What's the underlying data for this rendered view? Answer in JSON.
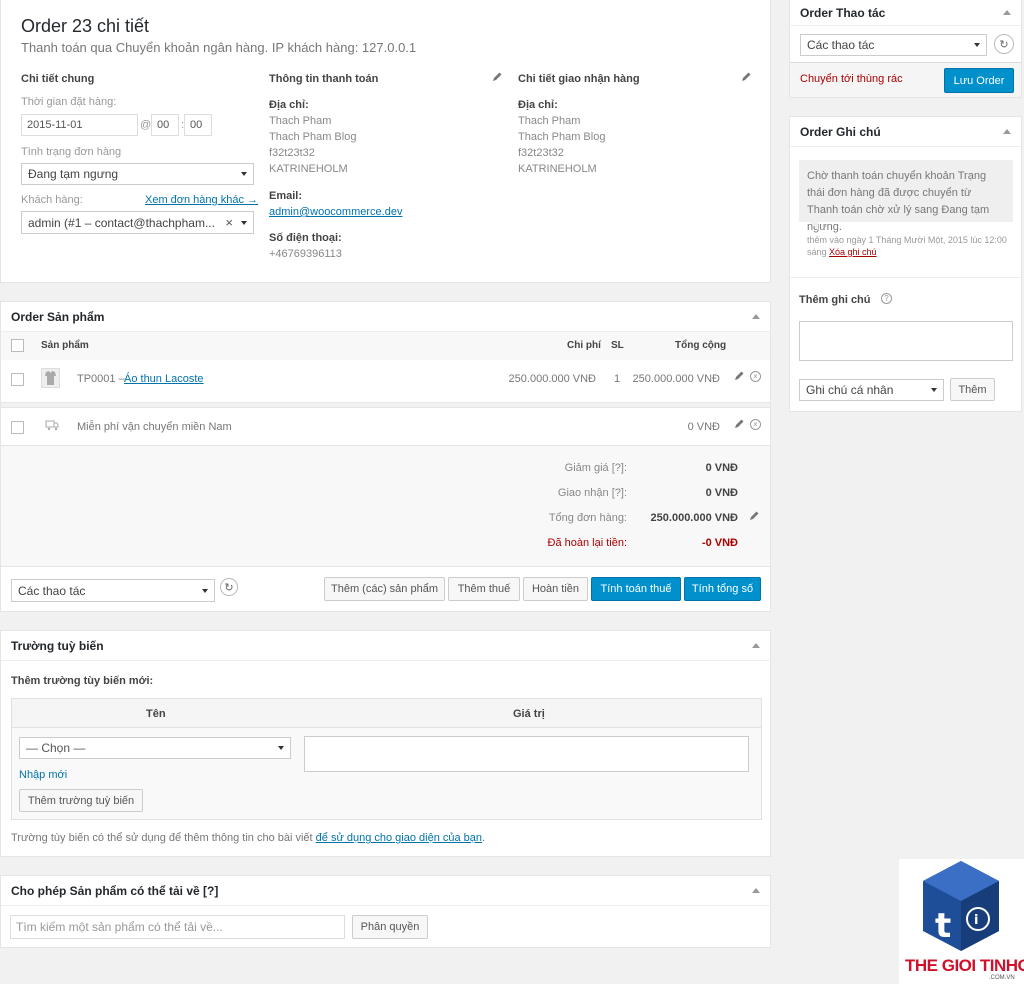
{
  "order": {
    "title": "Order 23 chi tiết",
    "subtitle": "Thanh toán qua Chuyển khoản ngân hàng. IP khách hàng: 127.0.0.1",
    "general": {
      "heading": "Chi tiết chung",
      "date_label": "Thời gian đặt hàng:",
      "date_value": "2015-11-01",
      "at": "@",
      "hour": "00",
      "colon": ":",
      "minute": "00",
      "status_label": "Tình trạng đơn hàng",
      "status_value": "Đang tạm ngưng",
      "customer_label": "Khách hàng:",
      "other_orders_link": "Xem đơn hàng khác →",
      "customer_value": "admin (#1 – contact@thachpham...",
      "clear": "×"
    },
    "billing": {
      "heading": "Thông tin thanh toán",
      "address_label": "Địa chỉ:",
      "address_lines": [
        "Thach Pham",
        "Thach Pham Blog",
        "f32t23t32",
        "KATRINEHOLM"
      ],
      "email_label": "Email:",
      "email_value": "admin@woocommerce.dev",
      "phone_label": "Số điện thoại:",
      "phone_value": "+46769396113"
    },
    "shipping": {
      "heading": "Chi tiết giao nhận hàng",
      "address_label": "Địa chỉ:",
      "address_lines": [
        "Thach Pham",
        "Thach Pham Blog",
        "f32t23t32",
        "KATRINEHOLM"
      ]
    }
  },
  "items": {
    "heading": "Order Sản phẩm",
    "col_product": "Sản phẩm",
    "col_cost": "Chi phí",
    "col_qty": "SL",
    "col_total": "Tổng cộng",
    "product": {
      "sku": "TP0001 – ",
      "name": "Áo thun Lacoste",
      "cost": "250.000.000 VNĐ",
      "qty": "1",
      "total": "250.000.000 VNĐ"
    },
    "shipping": {
      "name": "Miễn phí vận chuyển miền Nam",
      "total": "0 VNĐ"
    },
    "totals": {
      "discount_label": "Giảm giá [?]:",
      "discount_value": "0 VNĐ",
      "shipping_label": "Giao nhận [?]:",
      "shipping_value": "0 VNĐ",
      "order_total_label": "Tổng đơn hàng:",
      "order_total_value": "250.000.000 VNĐ",
      "refunded_label": "Đã hoàn lại tiền:",
      "refunded_value": "-0 VNĐ"
    },
    "bulk_actions": "Các thao tác",
    "buttons": {
      "add_products": "Thêm (các) sản phẩm",
      "add_tax": "Thêm thuế",
      "refund": "Hoàn tiền",
      "calc_tax": "Tính toán thuế",
      "calc_total": "Tính tổng số"
    }
  },
  "custom_fields": {
    "heading": "Trường tuỳ biến",
    "add_new": "Thêm trường tùy biến mới:",
    "col_name": "Tên",
    "col_value": "Giá trị",
    "select_placeholder": "— Chọn —",
    "enter_new": "Nhập mới",
    "add_button": "Thêm trường tuỳ biến",
    "note_prefix": "Trường tùy biến có thể sử dụng để thêm thông tin cho bài viết ",
    "note_link": "để sử dụng cho giao diện của bạn",
    "note_suffix": "."
  },
  "downloads": {
    "heading": "Cho phép Sản phẩm có thể tải về [?]",
    "search_placeholder": "Tìm kiếm một sản phẩm có thể tải về...",
    "grant_button": "Phân quyền"
  },
  "actions_box": {
    "heading": "Order Thao tác",
    "select_value": "Các thao tác",
    "trash_link": "Chuyển tới thùng rác",
    "save_button": "Lưu Order"
  },
  "notes_box": {
    "heading": "Order Ghi chú",
    "note_text": "Chờ thanh toán chuyển khoản Trạng thái đơn hàng đã được chuyển từ Thanh toán chờ xử lý sang Đang tạm ngưng.",
    "note_meta": "thêm vào ngày 1 Tháng Mười Một, 2015 lúc 12:00 sáng ",
    "delete_link": "Xóa ghi chú",
    "add_note_label": "Thêm ghi chú",
    "help": "?",
    "type_value": "Ghi chú cá nhân",
    "add_button": "Thêm"
  },
  "watermark": {
    "brand": "THE GIOI TINHOC",
    "sub": ".COM.VN"
  },
  "colors": {
    "primary": "#0091cd",
    "link": "#0073aa",
    "danger": "#a00"
  }
}
